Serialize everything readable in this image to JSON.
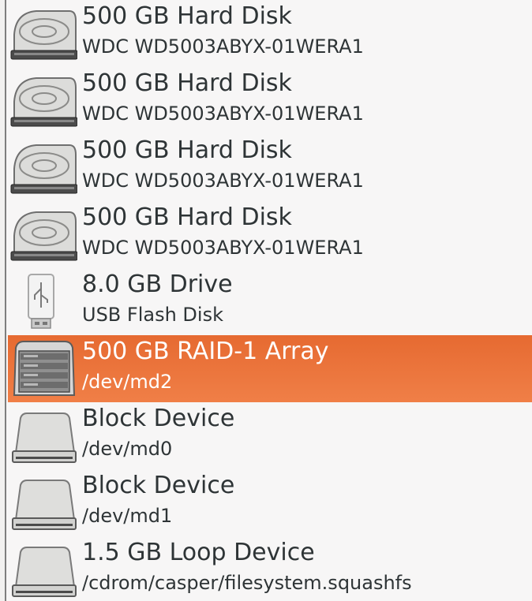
{
  "devices": [
    {
      "title": "500 GB Hard Disk",
      "subtitle": "WDC WD5003ABYX-01WERA1",
      "icon": "hard-disk-icon"
    },
    {
      "title": "500 GB Hard Disk",
      "subtitle": "WDC WD5003ABYX-01WERA1",
      "icon": "hard-disk-icon"
    },
    {
      "title": "500 GB Hard Disk",
      "subtitle": "WDC WD5003ABYX-01WERA1",
      "icon": "hard-disk-icon"
    },
    {
      "title": "500 GB Hard Disk",
      "subtitle": "WDC WD5003ABYX-01WERA1",
      "icon": "hard-disk-icon"
    },
    {
      "title": "8.0 GB Drive",
      "subtitle": "USB Flash Disk",
      "icon": "usb-drive-icon"
    },
    {
      "title": "500 GB RAID-1 Array",
      "subtitle": "/dev/md2",
      "icon": "raid-array-icon",
      "selected": true
    },
    {
      "title": "Block Device",
      "subtitle": "/dev/md0",
      "icon": "block-device-icon"
    },
    {
      "title": "Block Device",
      "subtitle": "/dev/md1",
      "icon": "block-device-icon"
    },
    {
      "title": "1.5 GB Loop Device",
      "subtitle": "/cdrom/casper/filesystem.squashfs",
      "icon": "block-device-icon"
    }
  ],
  "colors": {
    "selection": "#e66a31",
    "text": "#2e3436",
    "selected_text": "#ffffff",
    "background": "#f7f6f6"
  }
}
